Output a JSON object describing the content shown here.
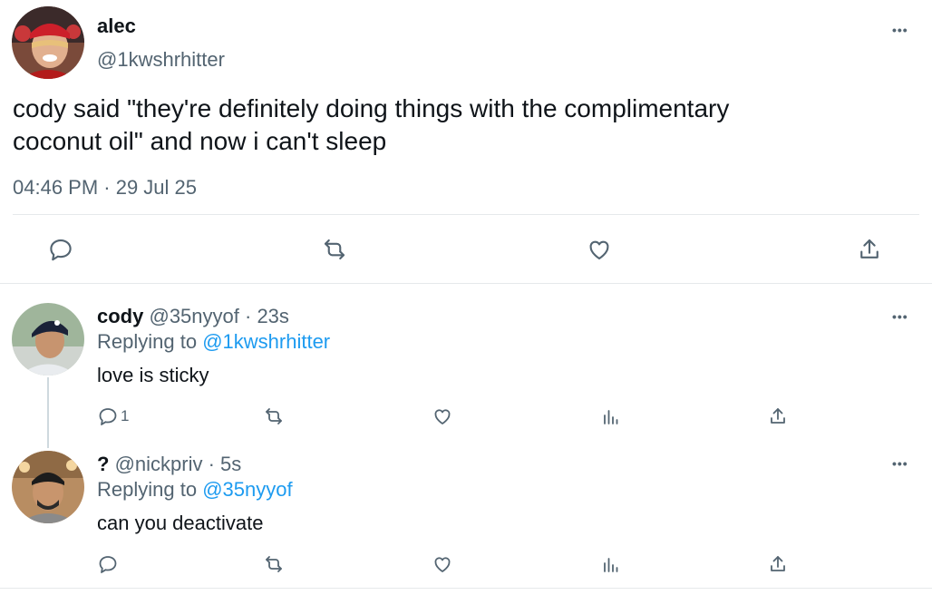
{
  "main_tweet": {
    "display_name": "alec",
    "handle": "@1kwshrhitter",
    "text_line1": "cody said \"they're definitely doing things with the complimentary",
    "text_line2": "coconut oil\" and now i can't sleep",
    "timestamp": "04:46 PM · 29 Jul 25",
    "more_label": "•••"
  },
  "replies": [
    {
      "display_name": "cody",
      "handle": "@35nyyof",
      "time": "· 23s",
      "replying_prefix": "Replying to",
      "replying_to": "@1kwshrhitter",
      "text": "love is sticky",
      "reply_count": "1",
      "more_label": "•••"
    },
    {
      "display_name": "?",
      "handle": "@nickpriv",
      "time": "· 5s",
      "replying_prefix": "Replying to",
      "replying_to": "@35nyyof",
      "text": "can you deactivate",
      "reply_count": "",
      "more_label": "•••"
    }
  ],
  "colors": {
    "text": "#0f1419",
    "muted": "#536471",
    "link": "#1d9bf0",
    "divider": "#e6e9eb"
  },
  "icons": [
    "reply-icon",
    "retweet-icon",
    "like-icon",
    "views-icon",
    "share-icon",
    "more-icon"
  ]
}
